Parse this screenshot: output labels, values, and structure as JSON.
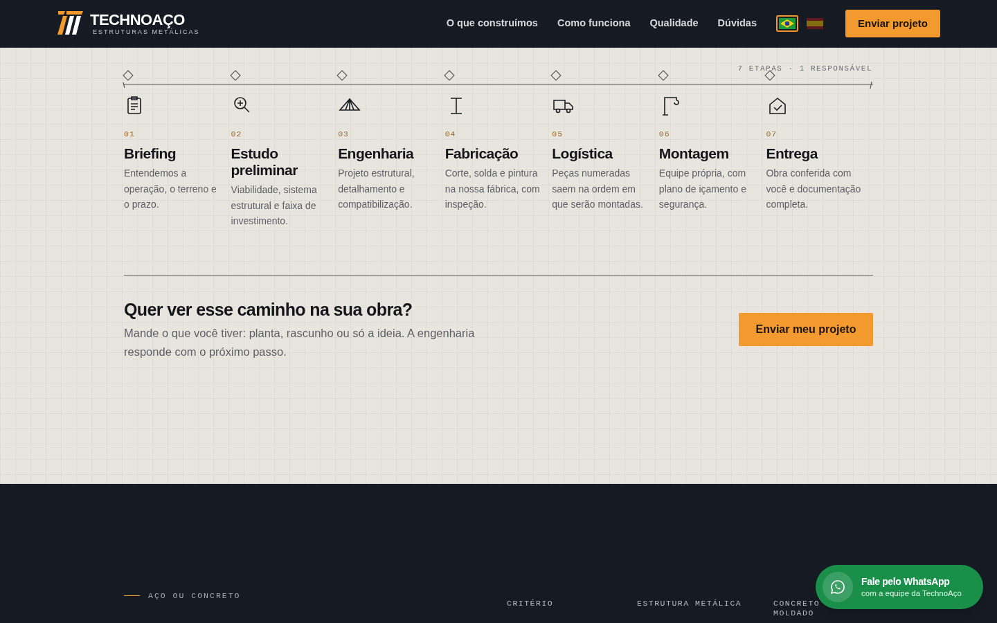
{
  "header": {
    "logo": {
      "name": "TECHNOAÇO",
      "tagline": "ESTRUTURAS METÁLICAS"
    },
    "nav": [
      "O que construímos",
      "Como funciona",
      "Qualidade",
      "Dúvidas"
    ],
    "languages": [
      {
        "selected": true
      },
      {
        "selected": false
      }
    ],
    "cta": "Enviar projeto"
  },
  "process": {
    "summary": "7 ETAPAS · 1 RESPONSÁVEL",
    "steps": [
      {
        "number": "01",
        "title": "Briefing",
        "text": "Entendemos a operação, o terreno e o prazo."
      },
      {
        "number": "02",
        "title": "Estudo preliminar",
        "text": "Viabilidade, sistema estrutural e faixa de investimento."
      },
      {
        "number": "03",
        "title": "Engenharia",
        "text": "Projeto estrutural, detalhamento e compatibilização."
      },
      {
        "number": "04",
        "title": "Fabricação",
        "text": "Corte, solda e pintura na nossa fábrica, com inspeção."
      },
      {
        "number": "05",
        "title": "Logística",
        "text": "Peças numeradas saem na ordem em que serão montadas."
      },
      {
        "number": "06",
        "title": "Montagem",
        "text": "Equipe própria, com plano de içamento e segurança."
      },
      {
        "number": "07",
        "title": "Entrega",
        "text": "Obra conferida com você e documentação completa."
      }
    ]
  },
  "cta_block": {
    "title": "Quer ver esse caminho na sua obra?",
    "text": "Mande o que você tiver: planta, rascunho ou só a ideia. A engenharia responde com o próximo passo.",
    "button": "Enviar meu projeto"
  },
  "comparison": {
    "eyebrow": "AÇO OU CONCRETO",
    "columns": [
      "CRITÉRIO",
      "ESTRUTURA METÁLICA",
      "CONCRETO MOLDADO"
    ]
  },
  "whatsapp": {
    "title": "Fale pelo WhatsApp",
    "subtitle": "com a equipe da TechnoAço"
  }
}
